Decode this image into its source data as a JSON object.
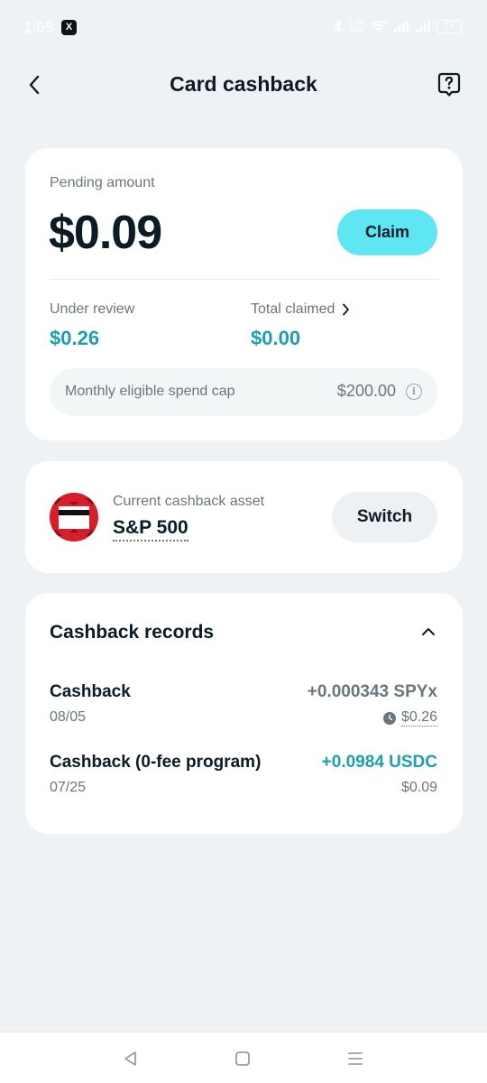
{
  "status_bar": {
    "time": "1:05",
    "app_badge": "X",
    "network_speed": "5.00",
    "network_unit": "KB/S",
    "battery": "77"
  },
  "header": {
    "title": "Card cashback",
    "back_icon": "chevron-left-icon",
    "help_icon": "question-icon"
  },
  "pending": {
    "label": "Pending amount",
    "amount": "$0.09",
    "claim_label": "Claim",
    "under_review_label": "Under review",
    "under_review_value": "$0.26",
    "total_claimed_label": "Total claimed",
    "total_claimed_value": "$0.00",
    "spend_cap_label": "Monthly eligible spend cap",
    "spend_cap_value": "$200.00"
  },
  "asset": {
    "label": "Current cashback asset",
    "name": "S&P 500",
    "switch_label": "Switch",
    "logo_color": "#d71f2b"
  },
  "records": {
    "title": "Cashback records",
    "items": [
      {
        "title": "Cashback",
        "date": "08/05",
        "amount": "+0.000343 SPYx",
        "fiat": "$0.26",
        "status": "pending"
      },
      {
        "title": "Cashback (0-fee program)",
        "date": "07/25",
        "amount": "+0.0984 USDC",
        "fiat": "$0.09",
        "status": "completed"
      }
    ]
  },
  "colors": {
    "accent": "#5ee6f2",
    "teal_text": "#1c9fae",
    "background": "#eff2f4"
  }
}
